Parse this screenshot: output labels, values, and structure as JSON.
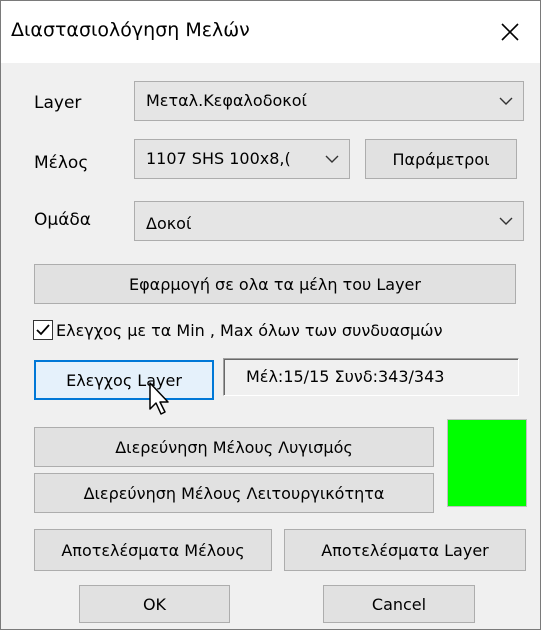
{
  "window": {
    "title": "Διαστασιολόγηση Μελών"
  },
  "layer": {
    "label": "Layer",
    "value": "Μεταλ.Κεφαλοδοκοί"
  },
  "member": {
    "label": "Μέλος",
    "value": "1107 SHS 100x8,(",
    "params_button": "Παράμετροι"
  },
  "group": {
    "label": "Ομάδα",
    "value": "Δοκοί"
  },
  "apply_all_button": "Εφαρμογή σε ολα τα μέλη του Layer",
  "minmax_check": {
    "label": "Ελεγχος με τα Min , Max όλων των συνδυασμών",
    "checked": true
  },
  "check_layer_button": "Ελεγχος Layer",
  "status_text": "Μέλ:15/15 Συνδ:343/343",
  "investigate_buckling_button": "Διερεύνηση Μέλους Λυγισμός",
  "investigate_service_button": "Διερεύνηση Μέλους Λειτουργικότητα",
  "status_color": "#00ff00",
  "member_results_button": "Αποτελέσματα Μέλους",
  "layer_results_button": "Αποτελέσματα Layer",
  "ok_button": "OK",
  "cancel_button": "Cancel",
  "icons": {
    "close": "close-icon",
    "dropdown": "chevron-down-icon",
    "check": "checkmark-icon",
    "cursor": "mouse-cursor-icon"
  }
}
